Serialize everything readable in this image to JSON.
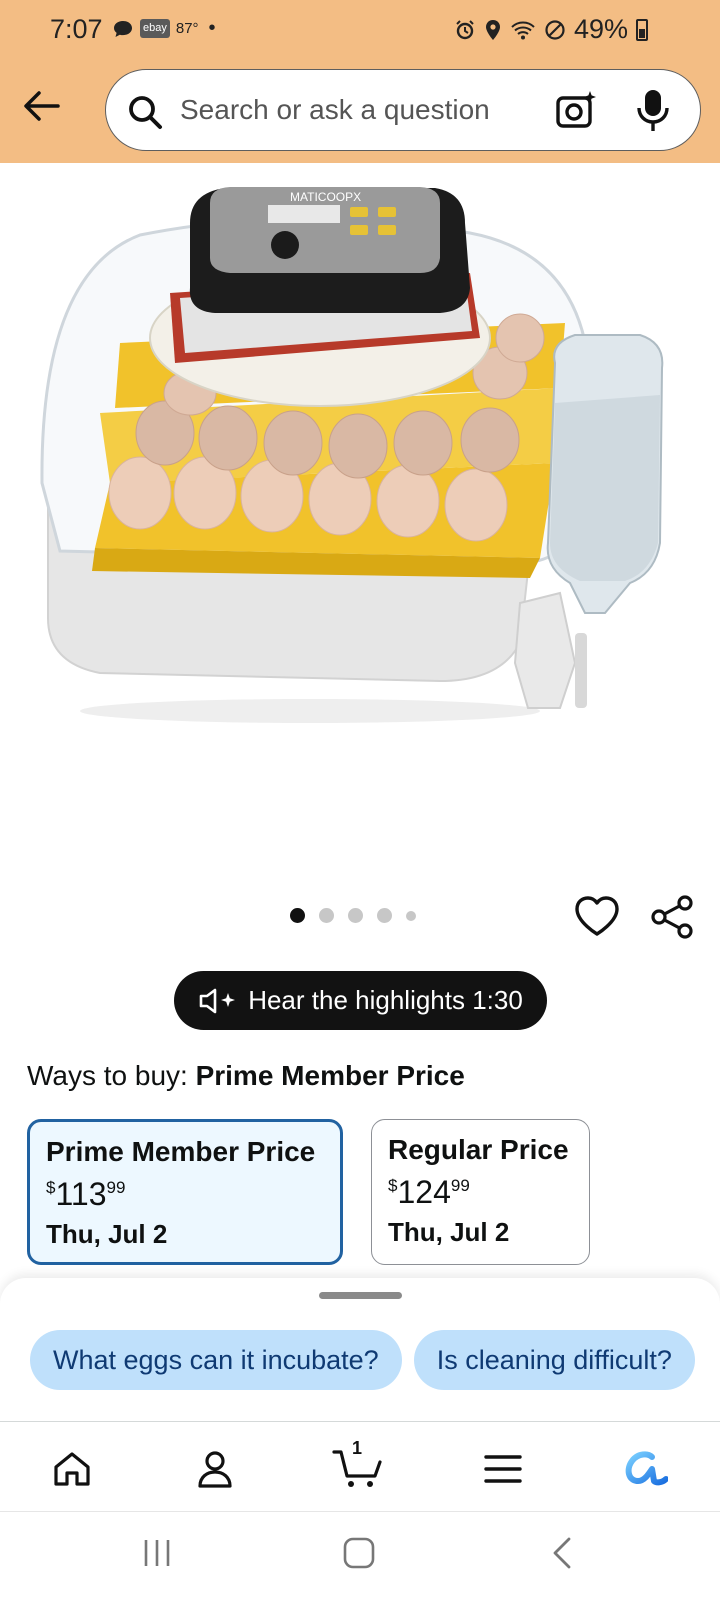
{
  "status_bar": {
    "time": "7:07",
    "ebay_badge": "ebay",
    "weather": "87°",
    "battery": "49%"
  },
  "header": {
    "search": {
      "placeholder": "Search or ask a question"
    }
  },
  "product": {
    "image_brand": "MATICOOPX",
    "carousel": {
      "count": 5,
      "active_index": 0
    }
  },
  "highlights": {
    "label": "Hear the highlights 1:30"
  },
  "ways_to_buy": {
    "prefix": "Ways to buy:",
    "selected": "Prime Member Price",
    "options": [
      {
        "title": "Prime Member Price",
        "currency": "$",
        "dollars": "113",
        "cents": "99",
        "delivery": "Thu, Jul 2",
        "selected": true
      },
      {
        "title": "Regular Price",
        "currency": "$",
        "dollars": "124",
        "cents": "99",
        "delivery": "Thu, Jul 2",
        "selected": false
      }
    ]
  },
  "rufus_sheet": {
    "chips": [
      "What eggs can it incubate?",
      "Is cleaning difficult?"
    ]
  },
  "bottom_nav": {
    "items": [
      "home-icon",
      "account-icon",
      "cart-icon",
      "menu-icon",
      "rufus-icon"
    ],
    "cart_count": "1"
  },
  "colors": {
    "header_bg": "#f3bd84",
    "selected_border": "#2162a1",
    "selected_bg": "#edf8ff",
    "chip_bg": "#bfe0fb",
    "chip_text": "#0f3a73",
    "rufus_accent": "#1a8cff",
    "tray_yellow": "#f1c22b"
  }
}
